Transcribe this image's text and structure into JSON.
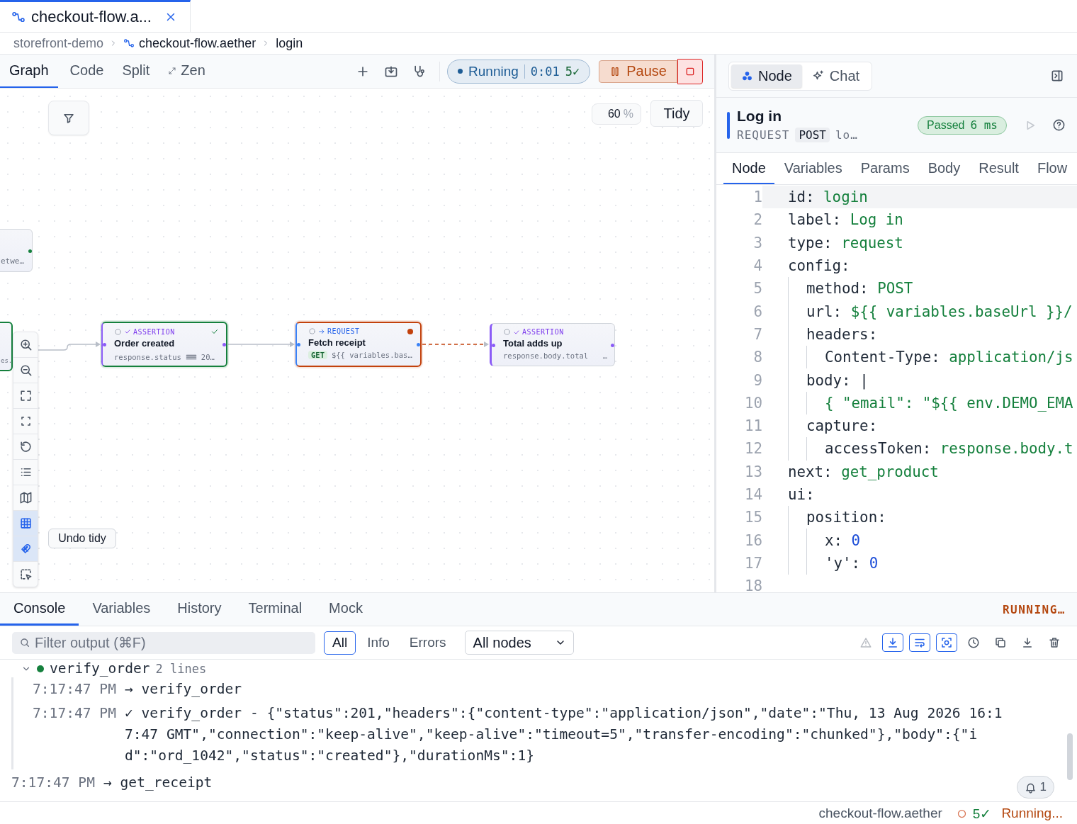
{
  "tabs": [
    {
      "label": "checkout-flow.a...",
      "selected": true
    }
  ],
  "breadcrumb": [
    {
      "label": "storefront-demo",
      "kind": "folder"
    },
    {
      "label": "checkout-flow.aether",
      "kind": "file"
    },
    {
      "label": "login",
      "kind": "node"
    }
  ],
  "toolbar": {
    "views": [
      {
        "label": "Graph",
        "selected": true
      },
      {
        "label": "Code",
        "selected": false
      },
      {
        "label": "Split",
        "selected": false
      },
      {
        "label": "Zen",
        "selected": false
      }
    ],
    "run": {
      "running": true,
      "label": "Running",
      "elapsed": "0:01",
      "passed": "5✓"
    },
    "pause": "Pause"
  },
  "canvas": {
    "zoom": "60",
    "zoom_unit": "%",
    "tidy": "Tidy",
    "undo": "Undo tidy",
    "tools": [
      {
        "selected": false
      },
      {
        "selected": false
      },
      {
        "selected": false
      },
      {
        "selected": false
      },
      {
        "selected": false
      },
      {
        "selected": false
      },
      {
        "selected": false
      },
      {
        "selected": true
      },
      {
        "selected": true
      },
      {
        "selected": false
      }
    ],
    "nodes": [
      {
        "kind": "clipped",
        "detail": "etwe…",
        "passed": true,
        "running": false
      },
      {
        "kind": "clipped",
        "detail": "es.",
        "passed": true,
        "running": false
      },
      {
        "kind": "assertion",
        "type_label": "ASSERTION",
        "title": "Order created",
        "detail": "response.status",
        "value": "20…",
        "passed": true,
        "running": false
      },
      {
        "kind": "request",
        "type_label": "REQUEST",
        "title": "Fetch receipt",
        "method": "GET",
        "detail": "${{ variables.bas…",
        "passed": false,
        "running": true
      },
      {
        "kind": "assertion",
        "type_label": "ASSERTION",
        "title": "Total adds up",
        "detail": "response.body.total",
        "value": "…",
        "passed": false,
        "running": false
      }
    ],
    "edges": [
      {
        "kind": "solid"
      },
      {
        "kind": "solid"
      },
      {
        "kind": "dashed"
      }
    ]
  },
  "inspector": {
    "modes": [
      {
        "label": "Node",
        "selected": true
      },
      {
        "label": "Chat",
        "selected": false
      }
    ],
    "title": "Log in",
    "type": "REQUEST",
    "method": "POST",
    "target": "lo…",
    "result": {
      "passed": true,
      "label": "Passed",
      "time": "6 ms"
    },
    "tabs": [
      {
        "label": "Node",
        "selected": true
      },
      {
        "label": "Variables",
        "selected": false
      },
      {
        "label": "Params",
        "selected": false
      },
      {
        "label": "Body",
        "selected": false
      },
      {
        "label": "Result",
        "selected": false
      },
      {
        "label": "Flow",
        "selected": false
      }
    ],
    "code": [
      {
        "n": "1",
        "key": "id:",
        "value": "login",
        "kind": "string"
      },
      {
        "n": "2",
        "key": "label:",
        "value": "Log in",
        "kind": "string"
      },
      {
        "n": "3",
        "key": "type:",
        "value": "request",
        "kind": "string"
      },
      {
        "n": "4",
        "key": "config:",
        "children": [
          {
            "n": "5",
            "key": "method:",
            "value": "POST",
            "kind": "string"
          },
          {
            "n": "6",
            "key": "url:",
            "value": "${{ variables.baseUrl }}/",
            "kind": "string"
          },
          {
            "n": "7",
            "key": "headers:",
            "children": [
              {
                "n": "8",
                "key": "Content-Type:",
                "value": "application/js",
                "kind": "string"
              }
            ]
          },
          {
            "n": "9",
            "key": "body:",
            "value": "|",
            "kind": "plain",
            "children": [
              {
                "n": "10",
                "value": "{ \"email\": \"${{ env.DEMO_EMA",
                "kind": "string"
              }
            ]
          },
          {
            "n": "11",
            "key": "capture:",
            "children": [
              {
                "n": "12",
                "key": "accessToken:",
                "value": "response.body.t",
                "kind": "string"
              }
            ]
          }
        ]
      },
      {
        "n": "13",
        "key": "next:",
        "value": "get_product",
        "kind": "string"
      },
      {
        "n": "14",
        "key": "ui:",
        "children": [
          {
            "n": "15",
            "key": "position:",
            "children": [
              {
                "n": "16",
                "key": "x:",
                "value": "0",
                "kind": "number"
              },
              {
                "n": "17",
                "key": "'y':",
                "value": "0",
                "kind": "number"
              }
            ]
          }
        ]
      },
      {
        "n": "18"
      }
    ]
  },
  "console": {
    "tabs": [
      {
        "label": "Console",
        "selected": true
      },
      {
        "label": "Variables",
        "selected": false
      },
      {
        "label": "History",
        "selected": false
      },
      {
        "label": "Terminal",
        "selected": false
      },
      {
        "label": "Mock",
        "selected": false
      }
    ],
    "state": "RUNNING…",
    "filter_placeholder": "Filter output (⌘F)",
    "levels": [
      {
        "label": "All",
        "selected": true
      },
      {
        "label": "Info",
        "selected": false
      },
      {
        "label": "Errors",
        "selected": false
      }
    ],
    "node_filter": "All nodes",
    "tools": [
      {
        "on": false
      },
      {
        "on": true
      },
      {
        "on": true
      },
      {
        "on": true
      },
      {
        "on": false
      },
      {
        "on": false
      },
      {
        "on": false
      },
      {
        "on": false
      }
    ],
    "log": [
      {
        "kind": "group",
        "name": "verify_order",
        "count": "2 lines",
        "expanded": true,
        "color": "#15803d",
        "entries": [
          {
            "time": "7:17:47 PM",
            "mark": "→",
            "text": "verify_order"
          },
          {
            "time": "7:17:47 PM",
            "mark": "✓",
            "text": "verify_order - {\"status\":201,\"headers\":{\"content-type\":\"application/json\",\"date\":\"Thu, 13 Aug 2026 16:17:47 GMT\",\"connection\":\"keep-alive\",\"keep-alive\":\"timeout=5\",\"transfer-encoding\":\"chunked\"},\"body\":{\"id\":\"ord_1042\",\"status\":\"created\"},\"durationMs\":1}"
          }
        ]
      },
      {
        "kind": "line",
        "time": "7:17:47 PM",
        "mark": "→",
        "text": "get_receipt"
      }
    ],
    "notifications": "1"
  },
  "status_bar": {
    "file": "checkout-flow.aether",
    "passed": "5✓",
    "state": "Running..."
  }
}
